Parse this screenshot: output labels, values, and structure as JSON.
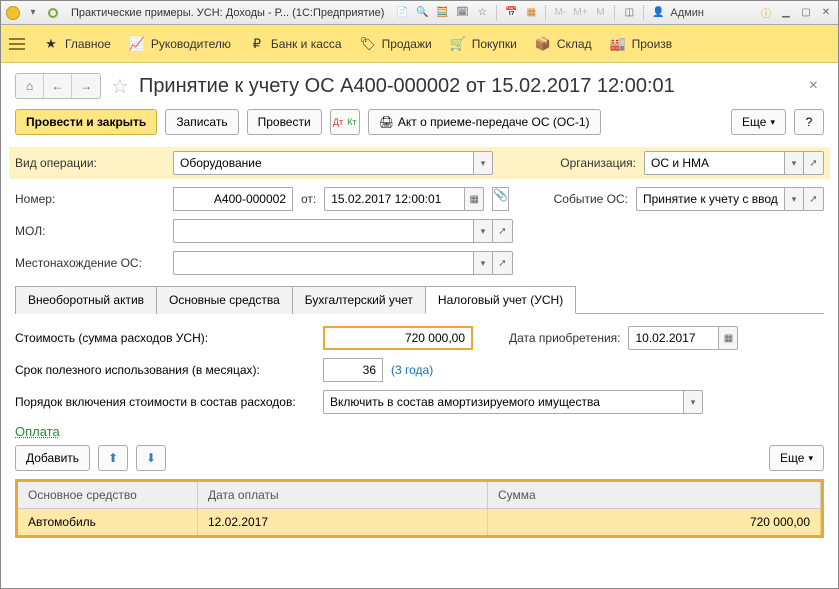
{
  "titlebar": {
    "title": "Практические примеры. УСН: Доходы - Р...  (1С:Предприятие)",
    "user": "Админ"
  },
  "nav": {
    "items": [
      "Главное",
      "Руководителю",
      "Банк и касса",
      "Продажи",
      "Покупки",
      "Склад",
      "Произв"
    ]
  },
  "page": {
    "title": "Принятие к учету ОС А400-000002 от 15.02.2017 12:00:01"
  },
  "toolbar": {
    "post_close": "Провести и закрыть",
    "save": "Записать",
    "post": "Провести",
    "act": "Акт о приеме-передаче ОС (ОС-1)",
    "more": "Еще",
    "help": "?"
  },
  "form": {
    "op_type_lbl": "Вид операции:",
    "op_type_val": "Оборудование",
    "org_lbl": "Организация:",
    "org_val": "ОС и НМА",
    "num_lbl": "Номер:",
    "num_val": "А400-000002",
    "date_lbl": "от:",
    "date_val": "15.02.2017 12:00:01",
    "event_lbl": "Событие ОС:",
    "event_val": "Принятие к учету с вводом",
    "mol_lbl": "МОЛ:",
    "mol_val": "",
    "loc_lbl": "Местонахождение ОС:",
    "loc_val": ""
  },
  "tabs": [
    "Внеоборотный актив",
    "Основные средства",
    "Бухгалтерский учет",
    "Налоговый учет (УСН)"
  ],
  "usn": {
    "cost_lbl": "Стоимость (сумма расходов УСН):",
    "cost_val": "720 000,00",
    "acq_lbl": "Дата приобретения:",
    "acq_val": "10.02.2017",
    "life_lbl": "Срок полезного использования (в месяцах):",
    "life_val": "36",
    "life_years": "(3 года)",
    "incl_lbl": "Порядок включения стоимости в состав расходов:",
    "incl_val": "Включить в состав амортизируемого имущества"
  },
  "payment": {
    "heading": "Оплата",
    "add": "Добавить",
    "more": "Еще",
    "cols": [
      "Основное средство",
      "Дата оплаты",
      "Сумма"
    ],
    "rows": [
      {
        "asset": "Автомобиль",
        "date": "12.02.2017",
        "sum": "720 000,00"
      }
    ]
  }
}
